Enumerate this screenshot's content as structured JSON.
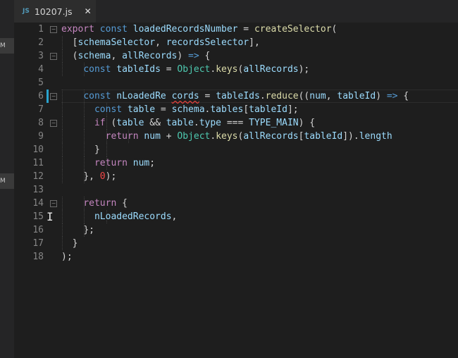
{
  "tab": {
    "icon_label": "JS",
    "file_name": "10207.js",
    "close_glyph": "✕"
  },
  "sidebar_fragments": [
    "M",
    "M"
  ],
  "line_numbers": [
    "1",
    "2",
    "3",
    "4",
    "5",
    "6",
    "7",
    "8",
    "9",
    "10",
    "11",
    "12",
    "13",
    "14",
    "15",
    "16",
    "17",
    "18"
  ],
  "code": [
    [
      {
        "t": "export",
        "c": "c-ctrl"
      },
      {
        "t": " "
      },
      {
        "t": "const",
        "c": "c-kw"
      },
      {
        "t": " "
      },
      {
        "t": "loadedRecordsNumber",
        "c": "c-var"
      },
      {
        "t": " = "
      },
      {
        "t": "createSelector",
        "c": "c-fn"
      },
      {
        "t": "("
      }
    ],
    [
      {
        "t": "  "
      },
      {
        "t": "["
      },
      {
        "t": "schemaSelector",
        "c": "c-var"
      },
      {
        "t": ", "
      },
      {
        "t": "recordsSelector",
        "c": "c-var"
      },
      {
        "t": "],"
      }
    ],
    [
      {
        "t": "  "
      },
      {
        "t": "("
      },
      {
        "t": "schema",
        "c": "c-var"
      },
      {
        "t": ", "
      },
      {
        "t": "allRecords",
        "c": "c-var"
      },
      {
        "t": ") "
      },
      {
        "t": "=>",
        "c": "c-kw"
      },
      {
        "t": " {"
      }
    ],
    [
      {
        "t": "    "
      },
      {
        "t": "const",
        "c": "c-kw"
      },
      {
        "t": " "
      },
      {
        "t": "tableIds",
        "c": "c-var"
      },
      {
        "t": " = "
      },
      {
        "t": "Object",
        "c": "c-type"
      },
      {
        "t": "."
      },
      {
        "t": "keys",
        "c": "c-fn"
      },
      {
        "t": "("
      },
      {
        "t": "allRecords",
        "c": "c-var"
      },
      {
        "t": ");"
      }
    ],
    [],
    [
      {
        "t": "    "
      },
      {
        "t": "const",
        "c": "c-kw"
      },
      {
        "t": " "
      },
      {
        "t": "nLoadedRe",
        "c": "c-var"
      },
      {
        "t": " "
      },
      {
        "t": "cords",
        "c": "c-var squiggle"
      },
      {
        "t": " = "
      },
      {
        "t": "tableIds",
        "c": "c-var"
      },
      {
        "t": "."
      },
      {
        "t": "reduce",
        "c": "c-fn"
      },
      {
        "t": "(("
      },
      {
        "t": "num",
        "c": "c-var"
      },
      {
        "t": ", "
      },
      {
        "t": "tableId",
        "c": "c-var"
      },
      {
        "t": ") "
      },
      {
        "t": "=>",
        "c": "c-kw"
      },
      {
        "t": " {"
      }
    ],
    [
      {
        "t": "      "
      },
      {
        "t": "const",
        "c": "c-kw"
      },
      {
        "t": " "
      },
      {
        "t": "table",
        "c": "c-var"
      },
      {
        "t": " = "
      },
      {
        "t": "schema",
        "c": "c-var"
      },
      {
        "t": "."
      },
      {
        "t": "tables",
        "c": "c-var"
      },
      {
        "t": "["
      },
      {
        "t": "tableId",
        "c": "c-var"
      },
      {
        "t": "];"
      }
    ],
    [
      {
        "t": "      "
      },
      {
        "t": "if",
        "c": "c-ctrl"
      },
      {
        "t": " ("
      },
      {
        "t": "table",
        "c": "c-var"
      },
      {
        "t": " && "
      },
      {
        "t": "table",
        "c": "c-var"
      },
      {
        "t": "."
      },
      {
        "t": "type",
        "c": "c-var"
      },
      {
        "t": " === "
      },
      {
        "t": "TYPE_MAIN",
        "c": "c-const"
      },
      {
        "t": ") {"
      }
    ],
    [
      {
        "t": "        "
      },
      {
        "t": "return",
        "c": "c-ctrl"
      },
      {
        "t": " "
      },
      {
        "t": "num",
        "c": "c-var"
      },
      {
        "t": " + "
      },
      {
        "t": "Object",
        "c": "c-type"
      },
      {
        "t": "."
      },
      {
        "t": "keys",
        "c": "c-fn"
      },
      {
        "t": "("
      },
      {
        "t": "allRecords",
        "c": "c-var"
      },
      {
        "t": "["
      },
      {
        "t": "tableId",
        "c": "c-var"
      },
      {
        "t": "])."
      },
      {
        "t": "length",
        "c": "c-var"
      }
    ],
    [
      {
        "t": "      "
      },
      {
        "t": "}"
      }
    ],
    [
      {
        "t": "      "
      },
      {
        "t": "return",
        "c": "c-ctrl"
      },
      {
        "t": " "
      },
      {
        "t": "num",
        "c": "c-var"
      },
      {
        "t": ";"
      }
    ],
    [
      {
        "t": "    "
      },
      {
        "t": "}, "
      },
      {
        "t": "0",
        "c": "c-num"
      },
      {
        "t": ");"
      }
    ],
    [],
    [
      {
        "t": "    "
      },
      {
        "t": "return",
        "c": "c-ctrl"
      },
      {
        "t": " {"
      }
    ],
    [
      {
        "t": "      "
      },
      {
        "t": "nLoadedRecords",
        "c": "c-var"
      },
      {
        "t": ","
      }
    ],
    [
      {
        "t": "    "
      },
      {
        "t": "};"
      }
    ],
    [
      {
        "t": "  "
      },
      {
        "t": "}"
      }
    ],
    [
      {
        "t": ");"
      }
    ]
  ],
  "folding_lines": [
    1,
    3,
    6,
    8,
    14
  ],
  "colors": {
    "background": "#1e1e1e",
    "keyword": "#569cd6",
    "control_keyword": "#c586c0",
    "variable": "#9cdcfe",
    "function": "#dcdcaa",
    "type": "#4ec9b0",
    "error_squiggle": "#e0413d",
    "modified_marker": "#2aa4cf"
  }
}
